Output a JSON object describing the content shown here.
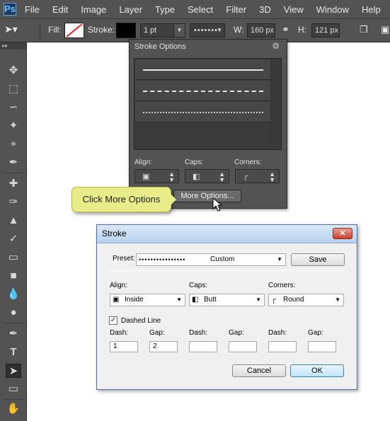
{
  "app": {
    "logo": "Ps"
  },
  "menu": [
    "File",
    "Edit",
    "Image",
    "Layer",
    "Type",
    "Select",
    "Filter",
    "3D",
    "View",
    "Window",
    "Help"
  ],
  "options_bar": {
    "fill_label": "Fill:",
    "stroke_label": "Stroke:",
    "stroke_width": "1 pt",
    "w_label": "W:",
    "w_value": "160 px",
    "h_label": "H:",
    "h_value": "121 px"
  },
  "stroke_panel": {
    "title": "Stroke Options",
    "presets": [
      "solid",
      "dashed",
      "dotted"
    ],
    "align_label": "Align:",
    "caps_label": "Caps:",
    "corners_label": "Corners:",
    "more_options_label": "More Options..."
  },
  "callout": {
    "text": "Click More Options"
  },
  "dialog": {
    "title": "Stroke",
    "preset_label": "Preset:",
    "preset_value": "Custom",
    "save_label": "Save",
    "align_label": "Align:",
    "align_value": "Inside",
    "caps_label": "Caps:",
    "caps_value": "Butt",
    "corners_label": "Corners:",
    "corners_value": "Round",
    "dashed_line_label": "Dashed Line",
    "dashed_line_checked": true,
    "dash_label": "Dash:",
    "gap_label": "Gap:",
    "dash1": "1",
    "gap1": "2",
    "dash2": "",
    "gap2": "",
    "dash3": "",
    "gap3": "",
    "cancel_label": "Cancel",
    "ok_label": "OK"
  },
  "colors": {
    "chrome": "#535353",
    "dialog_bg": "#f0f0f0",
    "callout": "#e8ed8a",
    "close_button": "#c8432f"
  }
}
